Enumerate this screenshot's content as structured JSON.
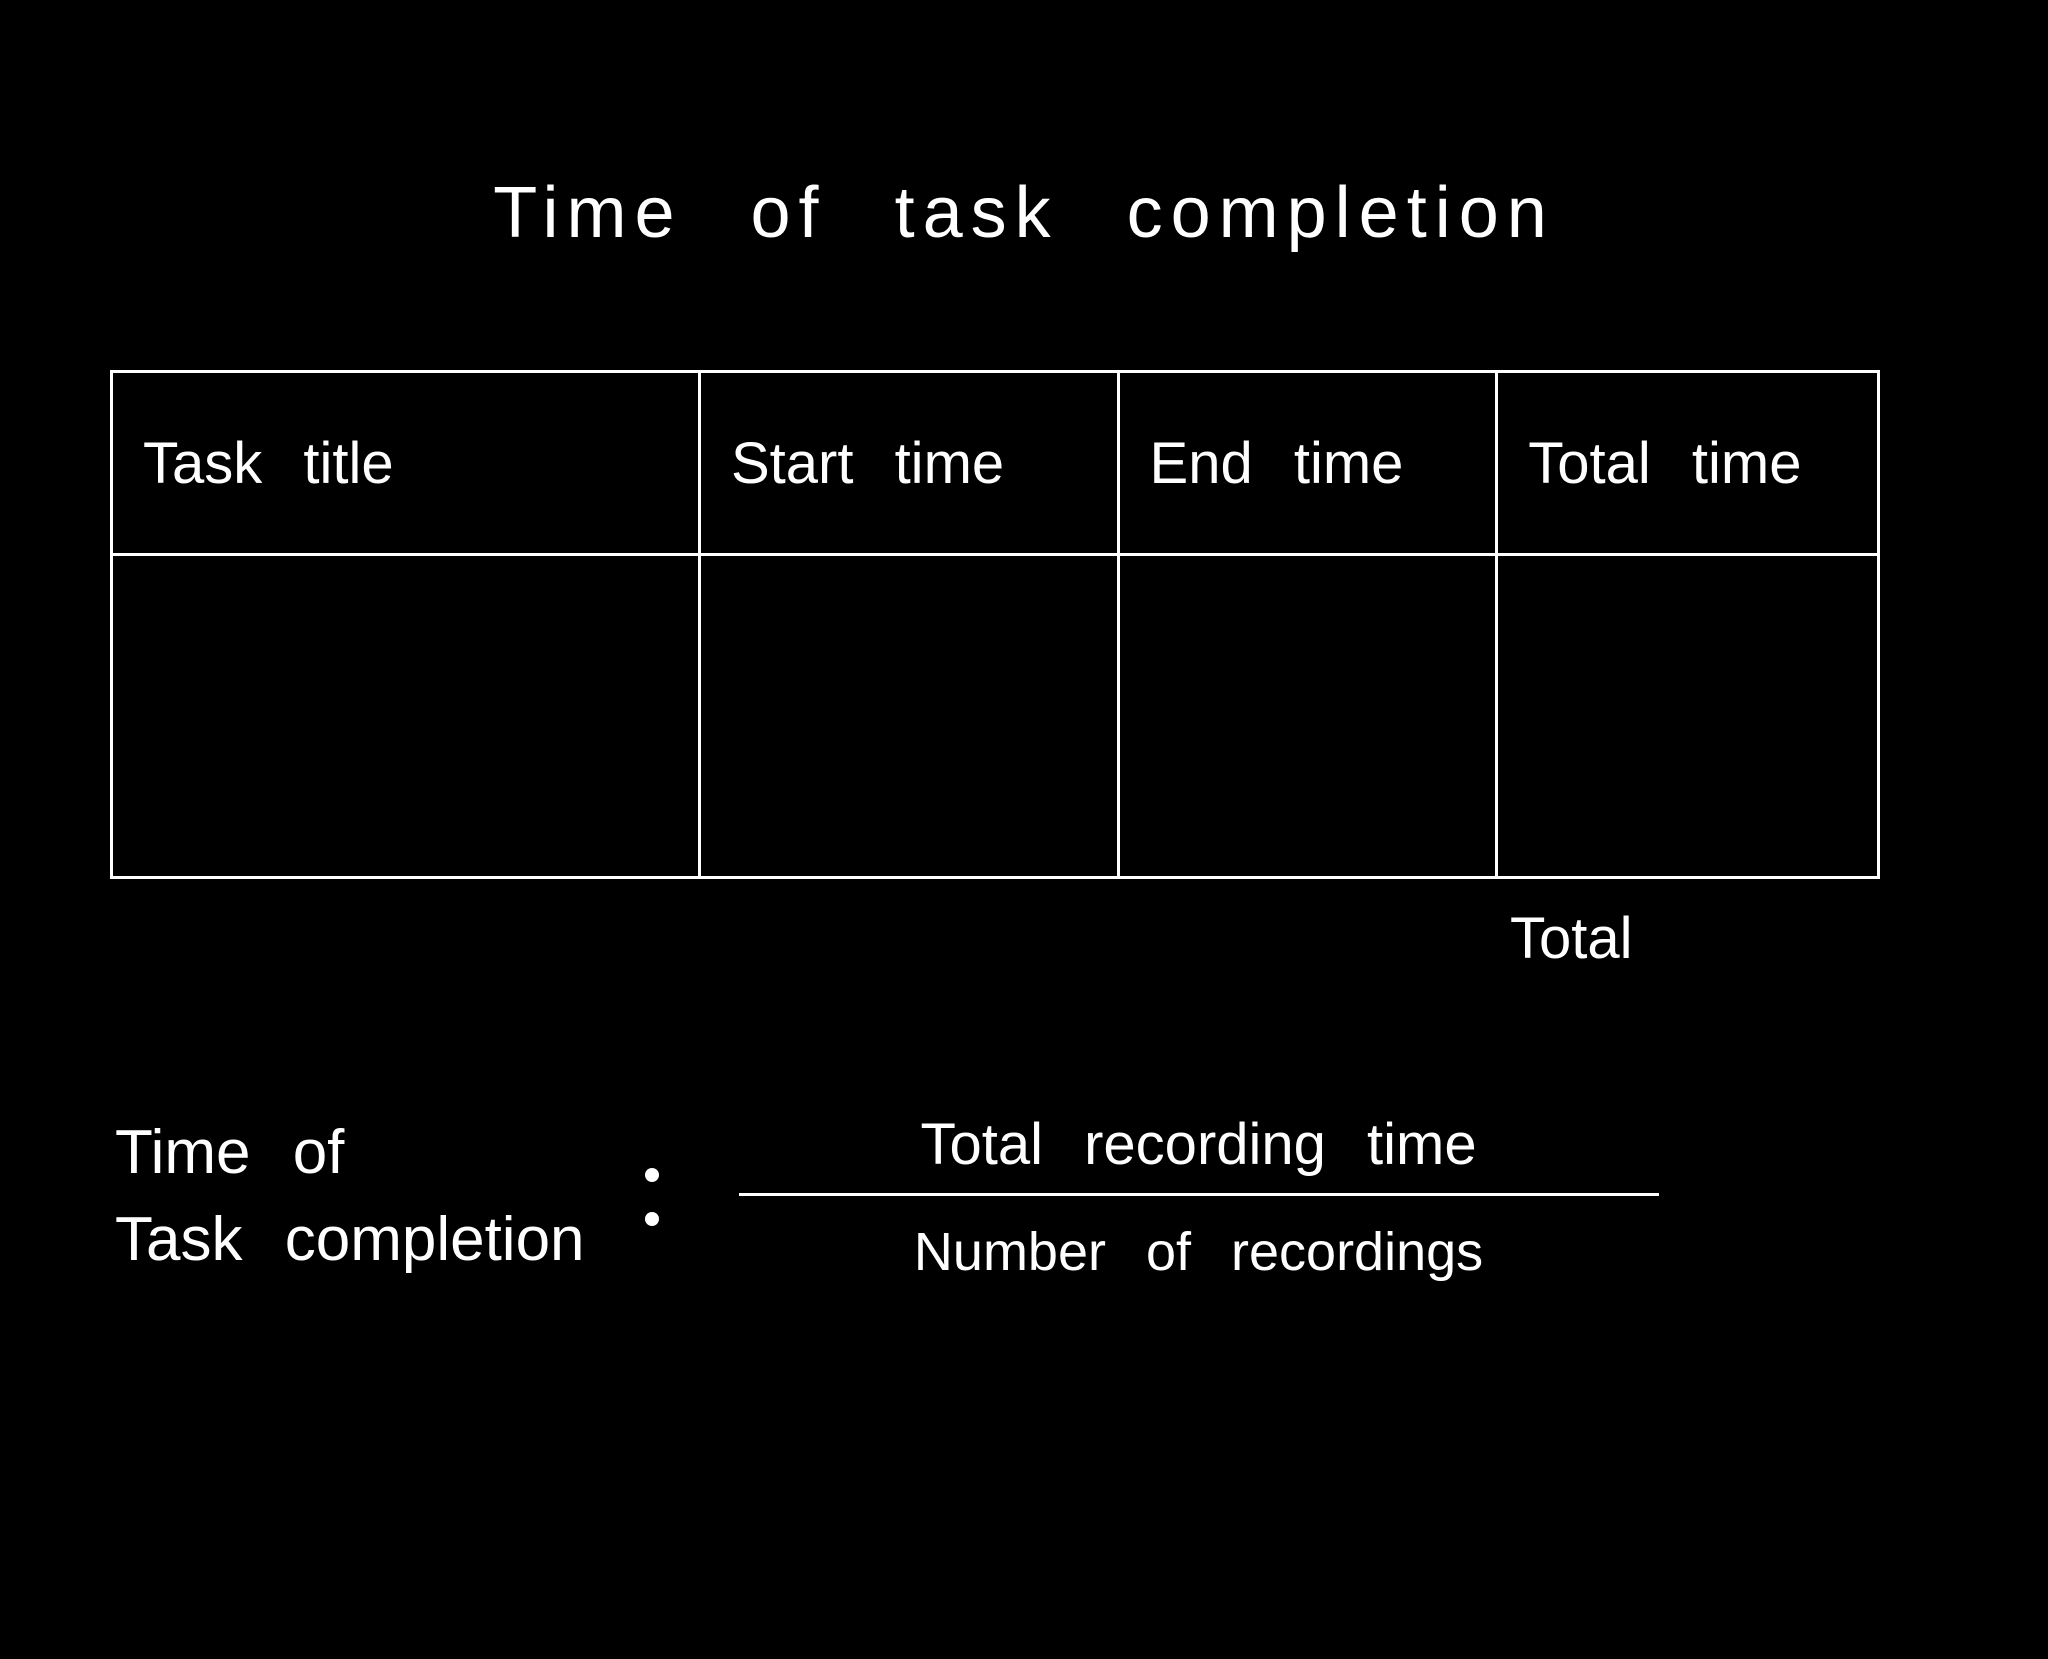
{
  "title": "Time of task completion",
  "table": {
    "headers": {
      "col1": "Task title",
      "col2": "Start time",
      "col3": "End time",
      "col4": "Total time"
    },
    "rows": [
      {
        "col1": "",
        "col2": "",
        "col3": "",
        "col4": ""
      }
    ],
    "total_label": "Total"
  },
  "formula": {
    "left_line1": "Time of",
    "left_line2": "Task completion",
    "numerator": "Total recording time",
    "denominator": "Number of recordings"
  }
}
